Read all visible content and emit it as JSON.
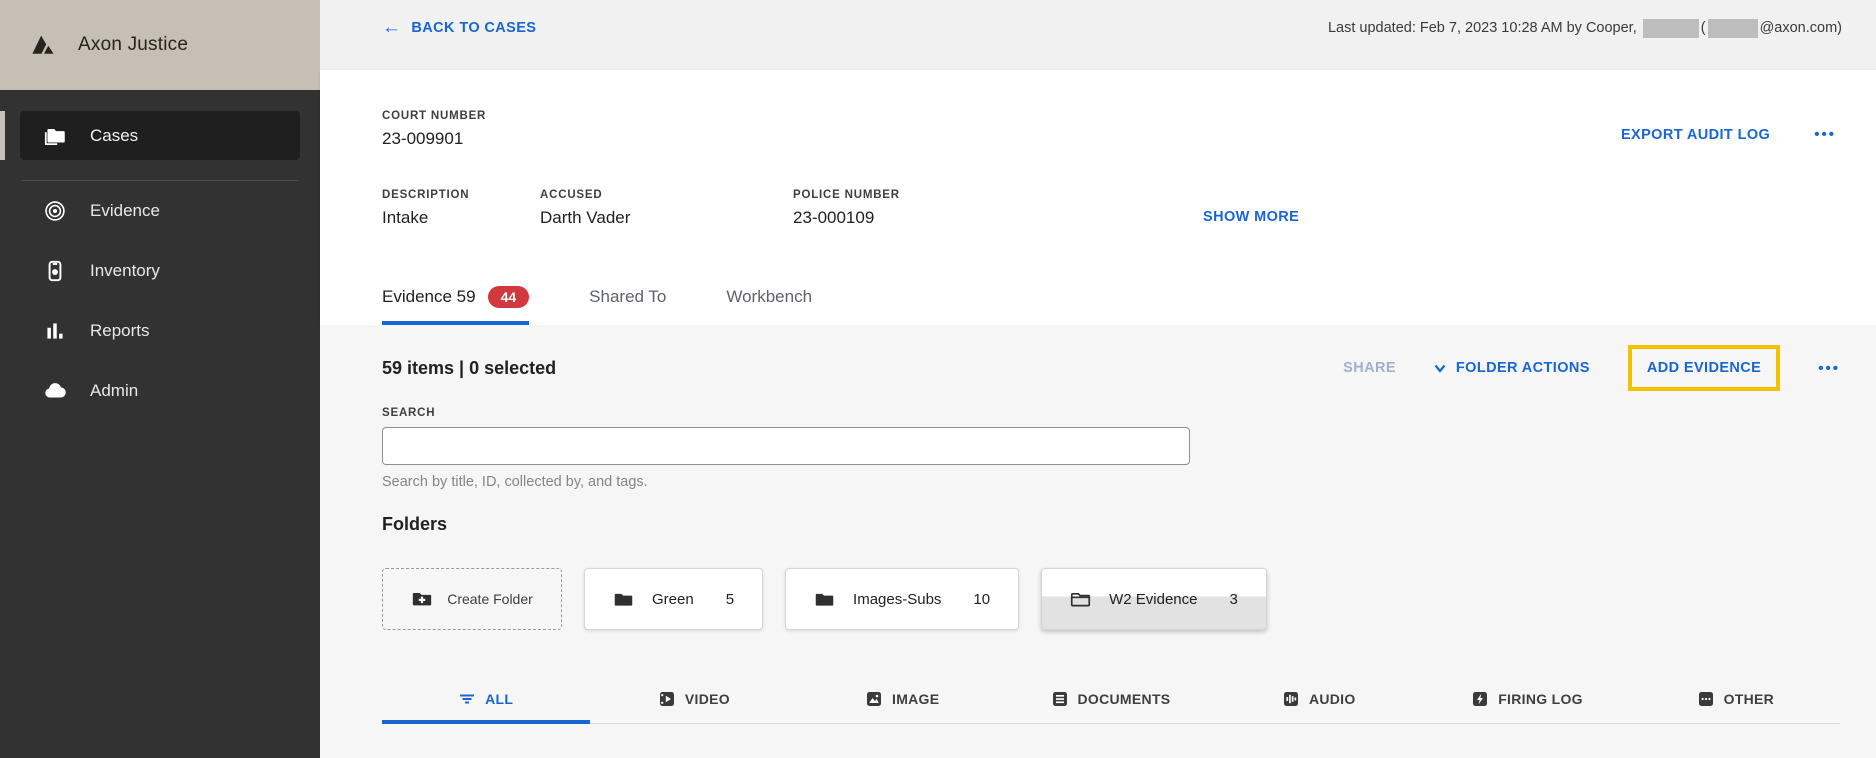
{
  "app": {
    "title": "Axon Justice"
  },
  "sidebar": {
    "items": [
      {
        "label": "Cases"
      },
      {
        "label": "Evidence"
      },
      {
        "label": "Inventory"
      },
      {
        "label": "Reports"
      },
      {
        "label": "Admin"
      }
    ]
  },
  "topbar": {
    "back_link": "BACK TO CASES",
    "back_arrow": "←",
    "last_updated_prefix": "Last updated: Feb 7, 2023 10:28 AM by Cooper,",
    "last_updated_paren": "(",
    "last_updated_suffix": "@axon.com)"
  },
  "case_header": {
    "court_number_label": "COURT NUMBER",
    "court_number": "23-009901",
    "export_audit_log": "EXPORT AUDIT LOG",
    "more": "•••",
    "fields": [
      {
        "label": "DESCRIPTION",
        "value": "Intake"
      },
      {
        "label": "ACCUSED",
        "value": "Darth Vader"
      },
      {
        "label": "POLICE NUMBER",
        "value": "23-000109"
      }
    ],
    "show_more": "SHOW MORE",
    "tabs": [
      {
        "label": "Evidence 59",
        "badge": "44"
      },
      {
        "label": "Shared To"
      },
      {
        "label": "Workbench"
      }
    ]
  },
  "toolbar": {
    "items_summary": "59 items | 0 selected",
    "share": "SHARE",
    "folder_actions": "FOLDER ACTIONS",
    "add_evidence": "ADD EVIDENCE",
    "more": "•••"
  },
  "search": {
    "label": "SEARCH",
    "value": "",
    "helper": "Search by title, ID, collected by, and tags."
  },
  "folders": {
    "heading": "Folders",
    "create_label": "Create Folder",
    "items": [
      {
        "name": "Green",
        "count": "5"
      },
      {
        "name": "Images-Subs",
        "count": "10"
      },
      {
        "name": "W2 Evidence",
        "count": "3"
      }
    ]
  },
  "filter_tabs": [
    {
      "label": "ALL"
    },
    {
      "label": "VIDEO"
    },
    {
      "label": "IMAGE"
    },
    {
      "label": "DOCUMENTS"
    },
    {
      "label": "AUDIO"
    },
    {
      "label": "FIRING LOG"
    },
    {
      "label": "OTHER"
    }
  ],
  "colors": {
    "accent_blue": "#1966d2",
    "badge_red": "#d2393f",
    "highlight_yellow": "#f2c100",
    "sidebar_dark": "#323232",
    "sidebar_header_beige": "#c6bfb5"
  }
}
